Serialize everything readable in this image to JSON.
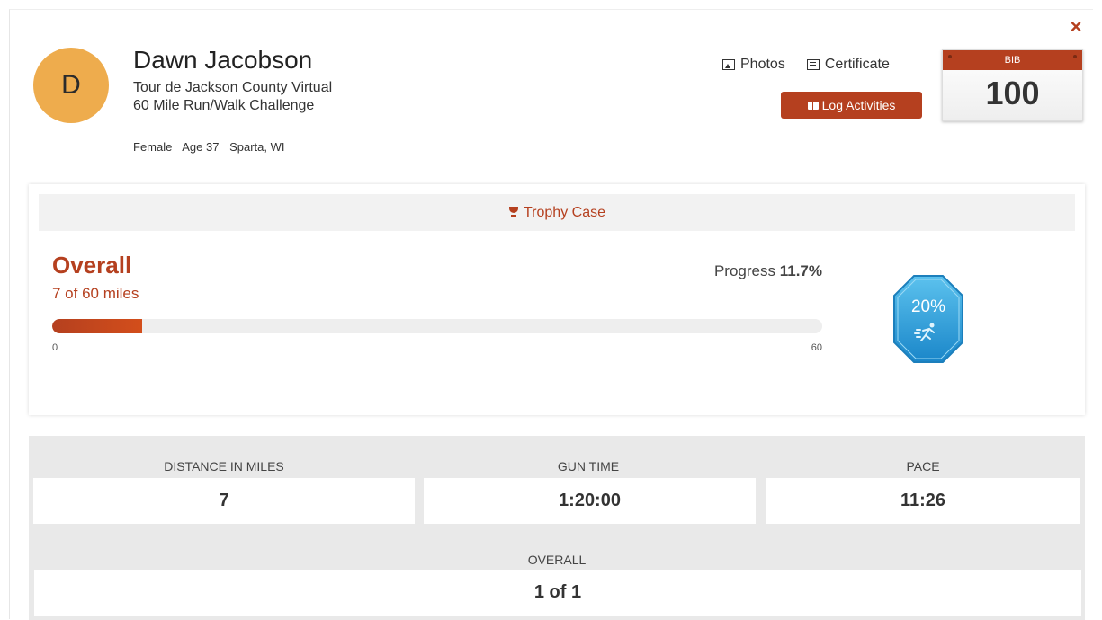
{
  "profile": {
    "initial": "D",
    "name": "Dawn Jacobson",
    "race": "Tour de Jackson County Virtual 60 Mile Run/Walk Challenge",
    "gender": "Female",
    "age": "Age 37",
    "location": "Sparta, WI"
  },
  "actions": {
    "photos_label": "Photos",
    "certificate_label": "Certificate",
    "log_activities_label": "Log Activities",
    "close_icon": "close-icon"
  },
  "bib": {
    "label": "BIB",
    "number": "100"
  },
  "progress": {
    "trophy_case_label": "Trophy Case",
    "title": "Overall",
    "subtitle": "7 of 60 miles",
    "progress_label": "Progress",
    "progress_value": "11.7%",
    "progress_fraction": 0.117,
    "scale_min": "0",
    "scale_max": "60",
    "badge_text": "20%",
    "badge_icon": "runner-icon"
  },
  "stats": {
    "distance_label": "DISTANCE IN MILES",
    "distance_value": "7",
    "gun_time_label": "GUN TIME",
    "gun_time_value": "1:20:00",
    "pace_label": "PACE",
    "pace_value": "11:26",
    "overall_label": "OVERALL",
    "overall_value": "1 of 1"
  },
  "colors": {
    "accent": "#b5401f",
    "avatar": "#eeac4d",
    "badge": "#2f9fd6"
  }
}
